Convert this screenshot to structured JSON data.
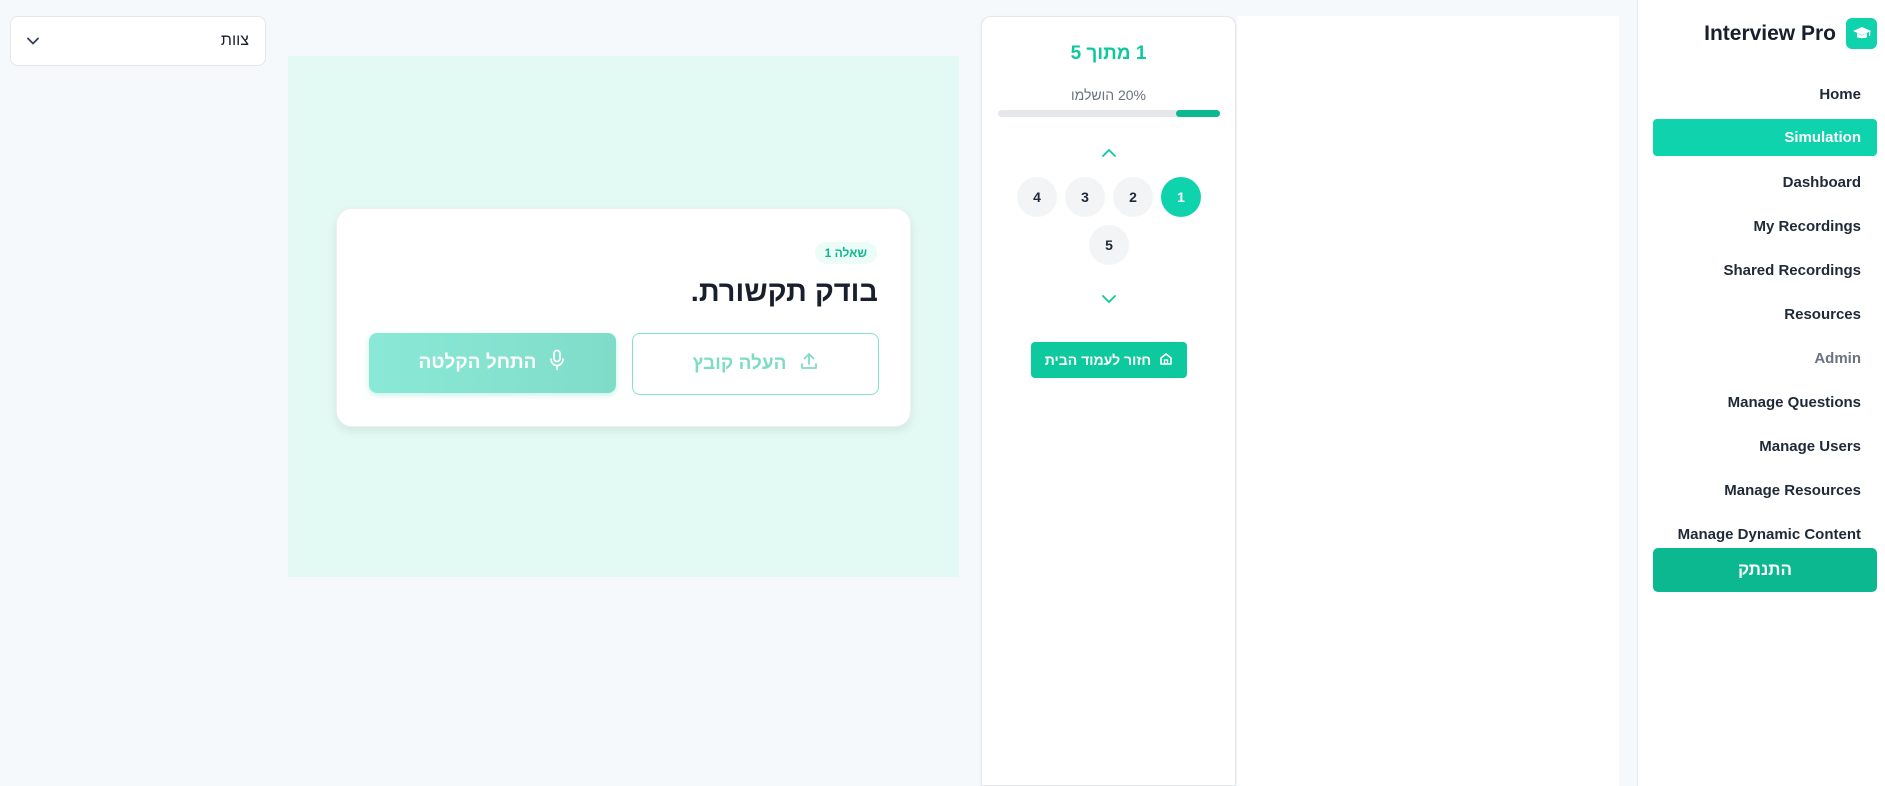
{
  "brand": {
    "title": "Interview Pro",
    "icon": "graduation-cap-icon"
  },
  "sidebar": {
    "items": [
      {
        "label": "Home",
        "active": false
      },
      {
        "label": "Simulation",
        "active": true
      },
      {
        "label": "Dashboard",
        "active": false
      },
      {
        "label": "My Recordings",
        "active": false
      },
      {
        "label": "Shared Recordings",
        "active": false
      },
      {
        "label": "Resources",
        "active": false
      }
    ],
    "admin_section": "Admin",
    "admin_items": [
      {
        "label": "Manage Questions"
      },
      {
        "label": "Manage Users"
      },
      {
        "label": "Manage Resources"
      },
      {
        "label": "Manage Dynamic Content"
      }
    ],
    "logout_label": "התנתק"
  },
  "progress": {
    "title": "1 מתוך 5",
    "percent_label": "20% הושלמו",
    "percent": 20,
    "questions": [
      "1",
      "2",
      "3",
      "4",
      "5"
    ],
    "current_question": "1",
    "home_button_label": "חזור לעמוד הבית"
  },
  "question_card": {
    "badge": "שאלה 1",
    "text": "בודק תקשורת.",
    "upload_label": "העלה קובץ",
    "record_label": "התחל הקלטה"
  },
  "team_select": {
    "selected": "צוות"
  },
  "colors": {
    "accent": "#0ed3ac",
    "accent_dark": "#0bb88f",
    "main_bg": "#e2faf3"
  }
}
